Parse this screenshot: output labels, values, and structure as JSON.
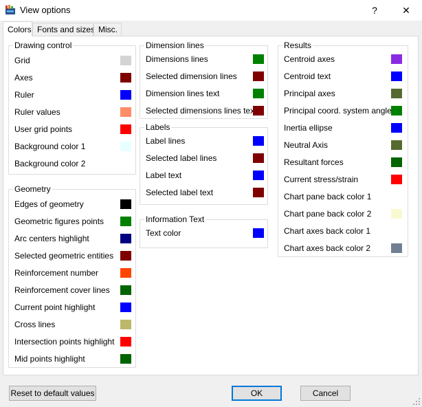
{
  "window": {
    "title": "View options",
    "help_label": "?",
    "close_label": "✕"
  },
  "tabs": [
    {
      "label": "Colors",
      "active": true
    },
    {
      "label": "Fonts and sizes",
      "active": false
    },
    {
      "label": "Misc.",
      "active": false
    }
  ],
  "groups": {
    "drawing_control": {
      "title": "Drawing control",
      "items": [
        {
          "label": "Grid",
          "color": "#d4d4d4"
        },
        {
          "label": "Axes",
          "color": "#800000"
        },
        {
          "label": "Ruler",
          "color": "#0000ff"
        },
        {
          "label": "Ruler values",
          "color": "#ff8c69"
        },
        {
          "label": "User grid points",
          "color": "#ff0000"
        },
        {
          "label": "Background color 1",
          "color": "#e8ffff"
        },
        {
          "label": "Background color 2",
          "color": "#ffffff"
        }
      ]
    },
    "geometry": {
      "title": "Geometry",
      "items": [
        {
          "label": "Edges of geometry",
          "color": "#000000"
        },
        {
          "label": "Geometric figures points",
          "color": "#008000"
        },
        {
          "label": "Arc centers highlight",
          "color": "#000080"
        },
        {
          "label": "Selected geometric entities",
          "color": "#800000"
        },
        {
          "label": "Reinforcement number",
          "color": "#ff4500"
        },
        {
          "label": "Reinforcement cover lines",
          "color": "#006400"
        },
        {
          "label": "Current point highlight",
          "color": "#0000ff"
        },
        {
          "label": "Cross lines",
          "color": "#bdb76b"
        },
        {
          "label": "Intersection points highlight",
          "color": "#ff0000"
        },
        {
          "label": "Mid points highlight",
          "color": "#006400"
        }
      ]
    },
    "dimension_lines": {
      "title": "Dimension lines",
      "items": [
        {
          "label": "Dimensions lines",
          "color": "#008000"
        },
        {
          "label": "Selected dimension lines",
          "color": "#800000"
        },
        {
          "label": "Dimension lines text",
          "color": "#008000"
        },
        {
          "label": "Selected dimensions lines text",
          "color": "#800000"
        }
      ]
    },
    "labels": {
      "title": "Labels",
      "items": [
        {
          "label": "Label lines",
          "color": "#0000ff"
        },
        {
          "label": "Selected label lines",
          "color": "#800000"
        },
        {
          "label": "Label text",
          "color": "#0000ff"
        },
        {
          "label": "Selected label text",
          "color": "#800000"
        }
      ]
    },
    "information_text": {
      "title": "Information Text",
      "items": [
        {
          "label": "Text color",
          "color": "#0000ff"
        }
      ]
    },
    "results": {
      "title": "Results",
      "items": [
        {
          "label": "Centroid axes",
          "color": "#8a2be2"
        },
        {
          "label": "Centroid text",
          "color": "#0000ff"
        },
        {
          "label": "Principal axes",
          "color": "#556b2f"
        },
        {
          "label": "Principal coord. system angle",
          "color": "#008000"
        },
        {
          "label": "Inertia ellipse",
          "color": "#0000ff"
        },
        {
          "label": "Neutral Axis",
          "color": "#556b2f"
        },
        {
          "label": "Resultant  forces",
          "color": "#006400"
        },
        {
          "label": "Current stress/strain",
          "color": "#ff0000"
        },
        {
          "label": "Chart pane back color 1",
          "color": "#ffffff"
        },
        {
          "label": "Chart pane back color 2",
          "color": "#fafad2"
        },
        {
          "label": "Chart axes back color 1",
          "color": "#ffffff"
        },
        {
          "label": "Chart axes back color 2",
          "color": "#708090"
        }
      ]
    }
  },
  "buttons": {
    "reset": "Reset to default values",
    "ok": "OK",
    "cancel": "Cancel"
  }
}
